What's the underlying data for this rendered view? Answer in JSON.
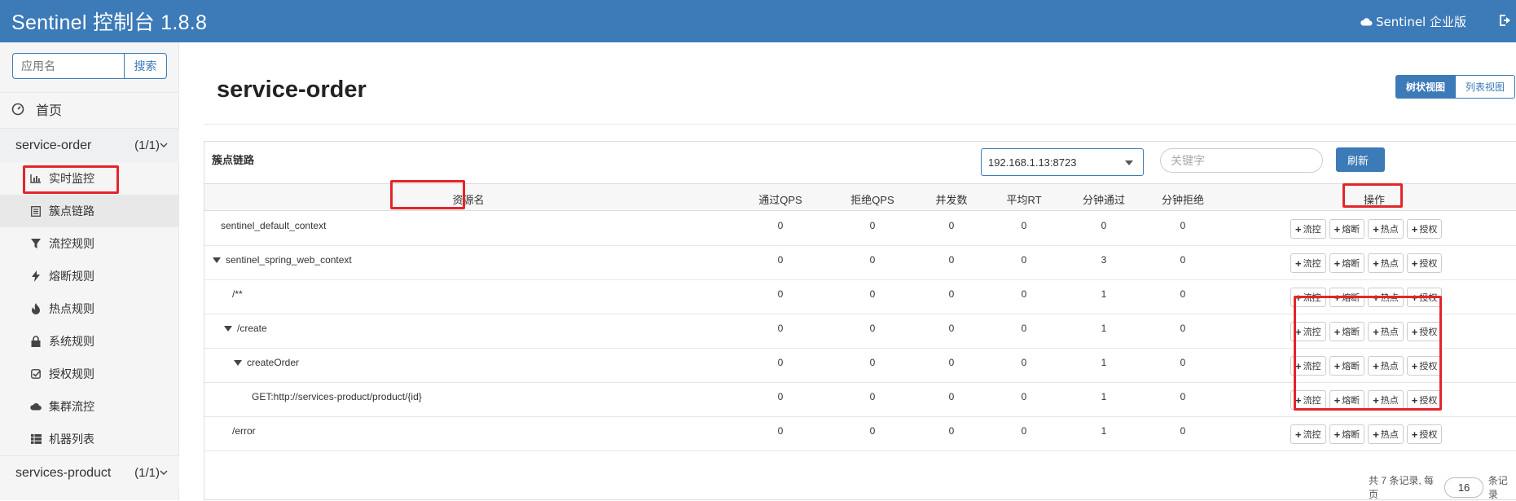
{
  "header": {
    "title": "Sentinel 控制台 1.8.8",
    "enterprise_label": "Sentinel 企业版",
    "accent_color": "#3c7ab8"
  },
  "sidebar": {
    "search_placeholder": "应用名",
    "search_button": "搜索",
    "home_label": "首页",
    "apps": [
      {
        "name": "service-order",
        "count": "(1/1)"
      },
      {
        "name": "services-product",
        "count": "(1/1)"
      }
    ],
    "menu": [
      {
        "label": "实时监控",
        "icon": "bar-chart-icon"
      },
      {
        "label": "簇点链路",
        "icon": "list-icon"
      },
      {
        "label": "流控规则",
        "icon": "filter-icon"
      },
      {
        "label": "熔断规则",
        "icon": "flash-icon"
      },
      {
        "label": "热点规则",
        "icon": "fire-icon"
      },
      {
        "label": "系统规则",
        "icon": "lock-icon"
      },
      {
        "label": "授权规则",
        "icon": "check-square-icon"
      },
      {
        "label": "集群流控",
        "icon": "cloud-icon"
      },
      {
        "label": "机器列表",
        "icon": "grid-list-icon"
      }
    ]
  },
  "main": {
    "page_title": "service-order",
    "view_tree": "树状视图",
    "view_list": "列表视图",
    "panel_title": "簇点链路",
    "machine": "192.168.1.13:8723",
    "keyword_placeholder": "关键字",
    "refresh": "刷新",
    "columns": [
      "资源名",
      "通过QPS",
      "拒绝QPS",
      "并发数",
      "平均RT",
      "分钟通过",
      "分钟拒绝",
      "操作"
    ],
    "op_labels": [
      "流控",
      "熔断",
      "热点",
      "授权"
    ],
    "rows": [
      {
        "name": "sentinel_default_context",
        "pass_qps": "0",
        "block_qps": "0",
        "concurrency": "0",
        "avg_rt": "0",
        "min_pass": "0",
        "min_block": "0"
      },
      {
        "name": "sentinel_spring_web_context",
        "pass_qps": "0",
        "block_qps": "0",
        "concurrency": "0",
        "avg_rt": "0",
        "min_pass": "3",
        "min_block": "0"
      },
      {
        "name": "/**",
        "pass_qps": "0",
        "block_qps": "0",
        "concurrency": "0",
        "avg_rt": "0",
        "min_pass": "1",
        "min_block": "0"
      },
      {
        "name": "/create",
        "pass_qps": "0",
        "block_qps": "0",
        "concurrency": "0",
        "avg_rt": "0",
        "min_pass": "1",
        "min_block": "0"
      },
      {
        "name": "createOrder",
        "pass_qps": "0",
        "block_qps": "0",
        "concurrency": "0",
        "avg_rt": "0",
        "min_pass": "1",
        "min_block": "0"
      },
      {
        "name": "GET:http://services-product/product/{id}",
        "pass_qps": "0",
        "block_qps": "0",
        "concurrency": "0",
        "avg_rt": "0",
        "min_pass": "1",
        "min_block": "0"
      },
      {
        "name": "/error",
        "pass_qps": "0",
        "block_qps": "0",
        "concurrency": "0",
        "avg_rt": "0",
        "min_pass": "1",
        "min_block": "0"
      }
    ],
    "pager": {
      "prefix": "共 7 条记录, 每页",
      "page_size": "16",
      "suffix": "条记录"
    },
    "highlight_color": "#e4252a"
  }
}
